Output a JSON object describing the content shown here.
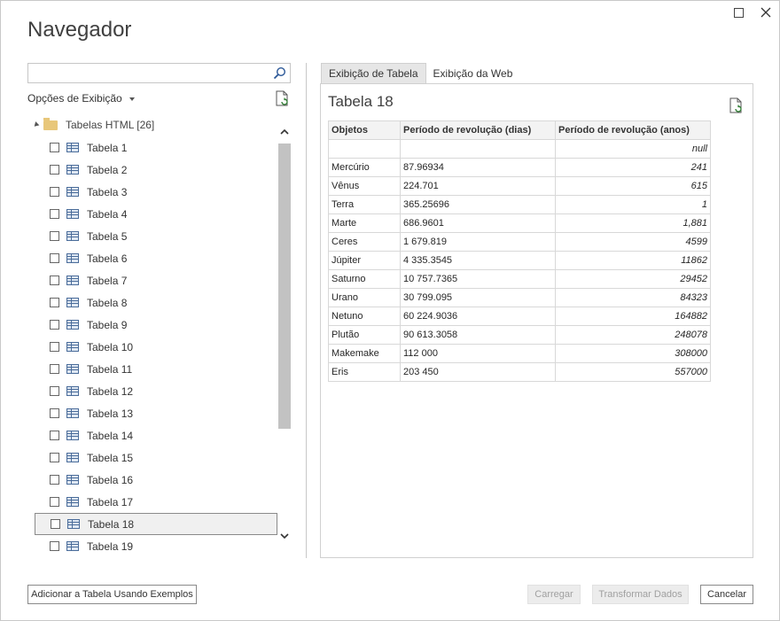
{
  "window": {
    "title": "Navegador"
  },
  "left": {
    "search_placeholder": "",
    "options_label": "Opções de Exibição",
    "root_label": "Tabelas HTML [26]",
    "items": [
      "Tabela 1",
      "Tabela 2",
      "Tabela 3",
      "Tabela 4",
      "Tabela 5",
      "Tabela 6",
      "Tabela 7",
      "Tabela 8",
      "Tabela 9",
      "Tabela 10",
      "Tabela 11",
      "Tabela 12",
      "Tabela 13",
      "Tabela 14",
      "Tabela 15",
      "Tabela 16",
      "Tabela 17",
      "Tabela 18",
      "Tabela 19"
    ],
    "selected_item": "Tabela 18"
  },
  "right": {
    "tabs": [
      "Exibição de Tabela",
      "Exibição da Web"
    ],
    "active_tab": "Exibição de Tabela",
    "table_title": "Tabela 18",
    "columns": [
      "Objetos",
      "Período de revolução (dias)",
      "Período de revolução (anos)"
    ],
    "rows": [
      [
        "",
        "",
        "null"
      ],
      [
        "Mercúrio",
        "87.96934",
        "241"
      ],
      [
        "Vênus",
        "224.701",
        "615"
      ],
      [
        "Terra",
        "365.25696",
        "1"
      ],
      [
        "Marte",
        "686.9601",
        "1,881"
      ],
      [
        "Ceres",
        "1 679.819",
        "4599"
      ],
      [
        "Júpiter",
        "4 335.3545",
        "11862"
      ],
      [
        "Saturno",
        "10 757.7365",
        "29452"
      ],
      [
        "Urano",
        "30 799.095",
        "84323"
      ],
      [
        "Netuno",
        "60 224.9036",
        "164882"
      ],
      [
        "Plutão",
        "90 613.3058",
        "248078"
      ],
      [
        "Makemake",
        "112 000",
        "308000"
      ],
      [
        "Eris",
        "203 450",
        "557000"
      ]
    ]
  },
  "footer": {
    "add_examples": "Adicionar a Tabela Usando Exemplos",
    "load": "Carregar",
    "transform": "Transformar Dados",
    "cancel": "Cancelar"
  }
}
